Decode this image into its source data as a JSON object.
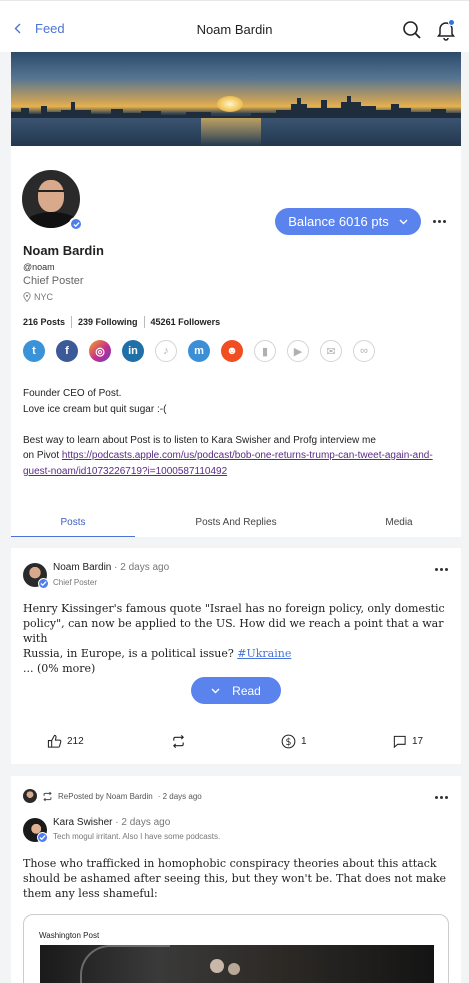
{
  "header": {
    "back_label": "Feed",
    "title": "Noam Bardin"
  },
  "profile": {
    "name": "Noam Bardin",
    "handle": "@noam",
    "role": "Chief Poster",
    "location": "NYC",
    "balance_label": "Balance 6016 pts",
    "stats": {
      "posts": "216 Posts",
      "following": "239 Following",
      "followers": "45261 Followers"
    },
    "socials": [
      {
        "name": "twitter",
        "glyph": "t",
        "color": "#3a93d8",
        "active": true
      },
      {
        "name": "facebook",
        "glyph": "f",
        "color": "#3d5a98",
        "active": true
      },
      {
        "name": "instagram",
        "glyph": "◎",
        "color": "#c42f8a",
        "active": true
      },
      {
        "name": "linkedin",
        "glyph": "in",
        "color": "#1f6fa8",
        "active": true
      },
      {
        "name": "tiktok",
        "glyph": "♪",
        "color": "#ffffff",
        "active": false
      },
      {
        "name": "mastodon",
        "glyph": "m",
        "color": "#3a8fd6",
        "active": true
      },
      {
        "name": "reddit",
        "glyph": "☻",
        "color": "#f04d22",
        "active": true
      },
      {
        "name": "substack",
        "glyph": "▮",
        "color": "#ffffff",
        "active": false
      },
      {
        "name": "youtube",
        "glyph": "▶",
        "color": "#ffffff",
        "active": false
      },
      {
        "name": "email",
        "glyph": "✉",
        "color": "#ffffff",
        "active": false
      },
      {
        "name": "link",
        "glyph": "∞",
        "color": "#ffffff",
        "active": false
      }
    ],
    "bio_line1": "Founder CEO of Post.",
    "bio_line2": "Love ice cream but quit sugar :-(",
    "bio_line3": "Best way to learn about Post is to listen to Kara Swisher and Profg interview me",
    "bio_line4_prefix": "on Pivot ",
    "bio_link": "https://podcasts.apple.com/us/podcast/bob-one-returns-trump-can-tweet-again-and-guest-noam/id1073226719?i=1000587110492"
  },
  "tabs": [
    "Posts",
    "Posts And Replies",
    "Media"
  ],
  "post1": {
    "author": "Noam Bardin",
    "time": "· 2 days ago",
    "subtitle": "Chief Poster",
    "text_line1": "Henry Kissinger's famous quote \"Israel has no foreign policy, only domestic",
    "text_line2": "policy\", can now be applied to the US. How did we reach a point that a war with",
    "text_line3_prefix": "Russia, in Europe, is a political issue? ",
    "hashtag": "#Ukraine",
    "text_more": "... (0% more)",
    "read_label": "Read",
    "likes": "212",
    "tips": "1",
    "comments": "17"
  },
  "post2": {
    "repost_label": "RePosted by Noam Bardin",
    "repost_time": "· 2 days ago",
    "author": "Kara Swisher",
    "time": "· 2 days ago",
    "subtitle": "Tech mogul irritant. Also I have some podcasts.",
    "text_line1": "Those who trafficked in homophobic conspiracy theories about this attack",
    "text_line2": "should be ashamed after seeing this, but they won't be. That does not make",
    "text_line3": "them any less shameful:",
    "embed_source": "Washington Post"
  }
}
